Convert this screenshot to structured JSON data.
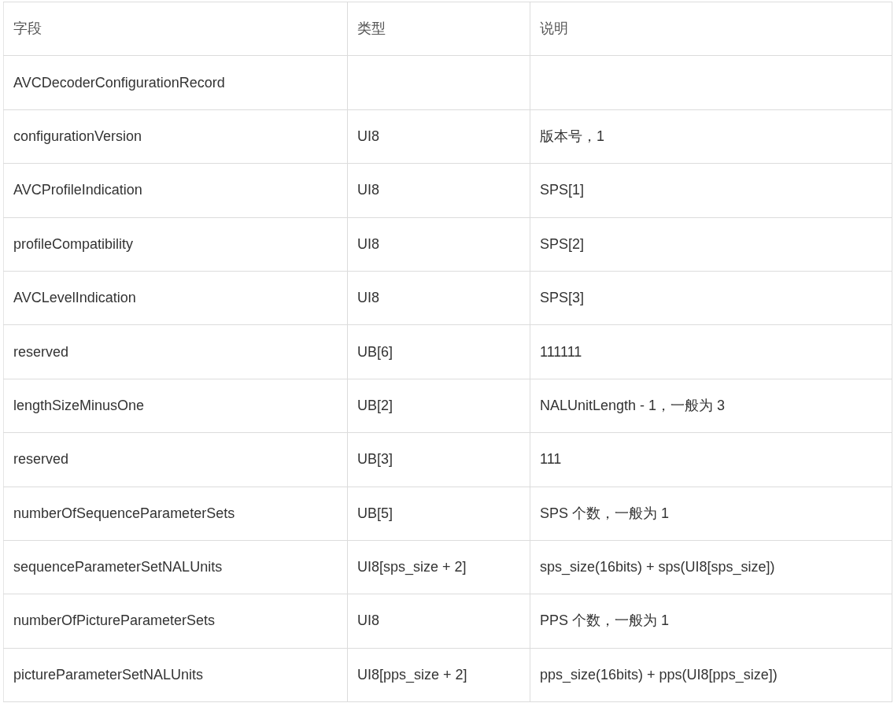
{
  "table": {
    "columns": [
      "字段",
      "类型",
      "说明"
    ],
    "rows": [
      {
        "field": "AVCDecoderConfigurationRecord"
      },
      {
        "field": "configurationVersion",
        "type": "UI8",
        "description": "版本号，1"
      },
      {
        "field": "AVCProfileIndication",
        "type": "UI8",
        "description": "SPS[1]"
      },
      {
        "field": "profileCompatibility",
        "type": "UI8",
        "description": "SPS[2]"
      },
      {
        "field": "AVCLevelIndication",
        "type": "UI8",
        "description": "SPS[3]"
      },
      {
        "field": "reserved",
        "type": "UB[6]",
        "description": "111111"
      },
      {
        "field": "lengthSizeMinusOne",
        "type": "UB[2]",
        "description": "NALUnitLength - 1，一般为 3"
      },
      {
        "field": "reserved",
        "type": "UB[3]",
        "description": "111"
      },
      {
        "field": "numberOfSequenceParameterSets",
        "type": "UB[5]",
        "description": "SPS 个数，一般为 1"
      },
      {
        "field": "sequenceParameterSetNALUnits",
        "type": "UI8[sps_size + 2]",
        "description": "sps_size(16bits) + sps(UI8[sps_size])"
      },
      {
        "field": "numberOfPictureParameterSets",
        "type": "UI8",
        "description": "PPS 个数，一般为 1"
      },
      {
        "field": "pictureParameterSetNALUnits",
        "type": "UI8[pps_size + 2]",
        "description": "pps_size(16bits) + pps(UI8[pps_size])"
      }
    ]
  }
}
